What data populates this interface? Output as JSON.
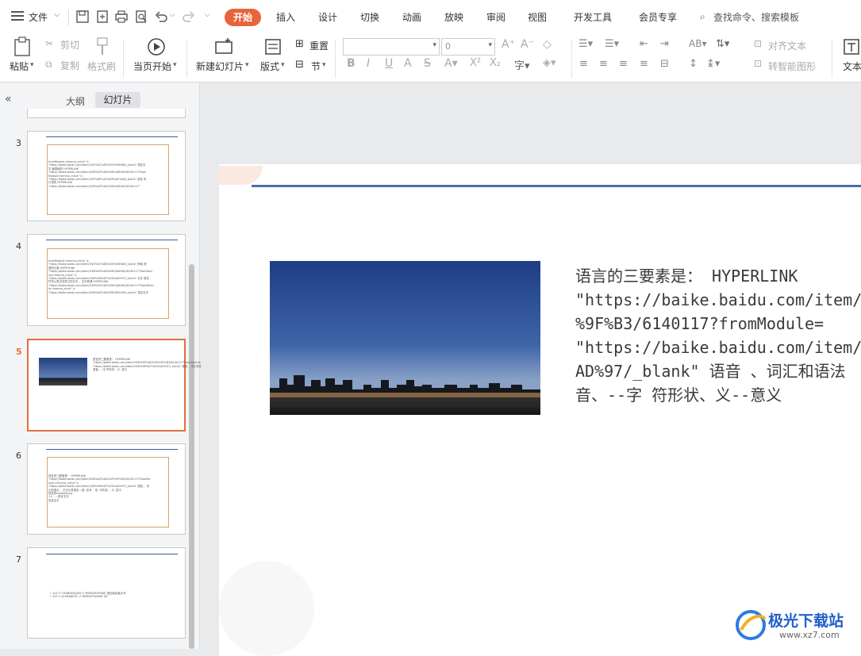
{
  "menu": {
    "label": "文件"
  },
  "tabs": [
    "开始",
    "插入",
    "设计",
    "切换",
    "动画",
    "放映",
    "审阅",
    "视图",
    "开发工具",
    "会员专享"
  ],
  "search": {
    "label": "查找命令、搜索模板"
  },
  "ribbon": {
    "paste": "粘贴",
    "cut": "剪切",
    "copy": "复制",
    "format_painter": "格式刷",
    "play_from_current": "当页开始",
    "new_slide": "新建幻灯片",
    "layout": "版式",
    "reset": "重置",
    "section": "节",
    "font_size": "0",
    "align_text": "对齐文本",
    "smart_art": "转智能图形",
    "text": "文本"
  },
  "panel": {
    "outline_tab": "大纲",
    "slides_tab": "幻灯片",
    "slides": [
      {
        "num": "3",
        "text": "fromModule=lemma_inlink\" \\t\n\"https://baike.baidu.com/item/%E5%9C%B0%E5%9B%BE/_blank\" 语言文\n字 最基础的 HYPERLINK\n\"https://baike.baidu.com/item/%E8%AF%AD%E8%A8%80/6140117?from\nModule=lemma_inlink\" \\t\n\"https://baike.baidu.com/item/%E5%8F%A3%E8%AF%AD/_blank\" 语言 听\n口语的 HYPERLINK\n\"https://baike.baidu.com/item/%E8%AF%AD%E8%A8%80/6140117\""
      },
      {
        "num": "4",
        "text": "fromModule=lemma_inlink\" \\t\n\"https://baike.baidu.com/item/%E5%9C%B0%E5%9B%BE/_blank\" 声韵 语\n音的元素 HYPERLINK\n\"https://baike.baidu.com/item/%E8%AF%AD%E8%A8%80/6140117?fromMod\nule=lemma_inlink\" \\t\n\"https://baike.baidu.com/item/%E6%96%87%E5%AD%97/_blank\" 文字 语言\n符号以表达的意义的文字 。文字称谓 HYPERLINK\n\"https://baike.baidu.com/item/%E8%AF%AD%E8%A8%80/6140117?fromModu\nle=lemma_inlink\" \\t\n\"https://baike.baidu.com/item/%E8%AF%AD%E6%B3%95/_blank\" 语法文字"
      },
      {
        "num": "5",
        "text": "语言的三要素是： HYPERLINK\n\"https://baike.baidu.com/item/%E8%AF%AD%E9%9F%B3/6140117?fromModule=lemma_inlink\" \\t\n\"https://baike.baidu.com/item/%E6%96%87%E5%AD%97/_blank\" 语音 、词汇和语法。\n语音、--字 符形状、义--意义"
      },
      {
        "num": "6",
        "text": "语言的三要素是： HYPERLINK\n\"https://baike.baidu.com/item/%E8%AF%AD%E9%9F%B3/6140117?fromMo\ndule=lemma_inlink\" \\t\n\"https://baike.baidu.com/item/%E6%96%87%E5%AD%97/_blank\" 语音 、词\n汇和语法 。文字记录语言 --音--形状 、形--字形状 、义--意义\n语言的symbolising\n+h  ----语言文字\n包括文字"
      },
      {
        "num": "7",
        "text": "• 123 \\* CHINESENUM3 \\* MERGEFORMAT 壹佰贰拾叁大写\n• 123 \\* ALPHABETIC \\* MERGEFORMAT DS"
      }
    ]
  },
  "slide": {
    "text": "语言的三要素是： HYPERLINK\n\"https://baike.baidu.com/item/%\n%9F%B3/6140117?fromModule=\n\"https://baike.baidu.com/item/%\nAD%97/_blank\" 语音 、词汇和语法\n音、--字 符形状、义--意义",
    "image_alt": "城市夜景"
  },
  "watermark": {
    "title": "极光下载站",
    "url": "www.xz7.com"
  },
  "colors": {
    "accent": "#e8643c",
    "slide_rule": "#4a6db5",
    "frame": "#d9a36b"
  }
}
